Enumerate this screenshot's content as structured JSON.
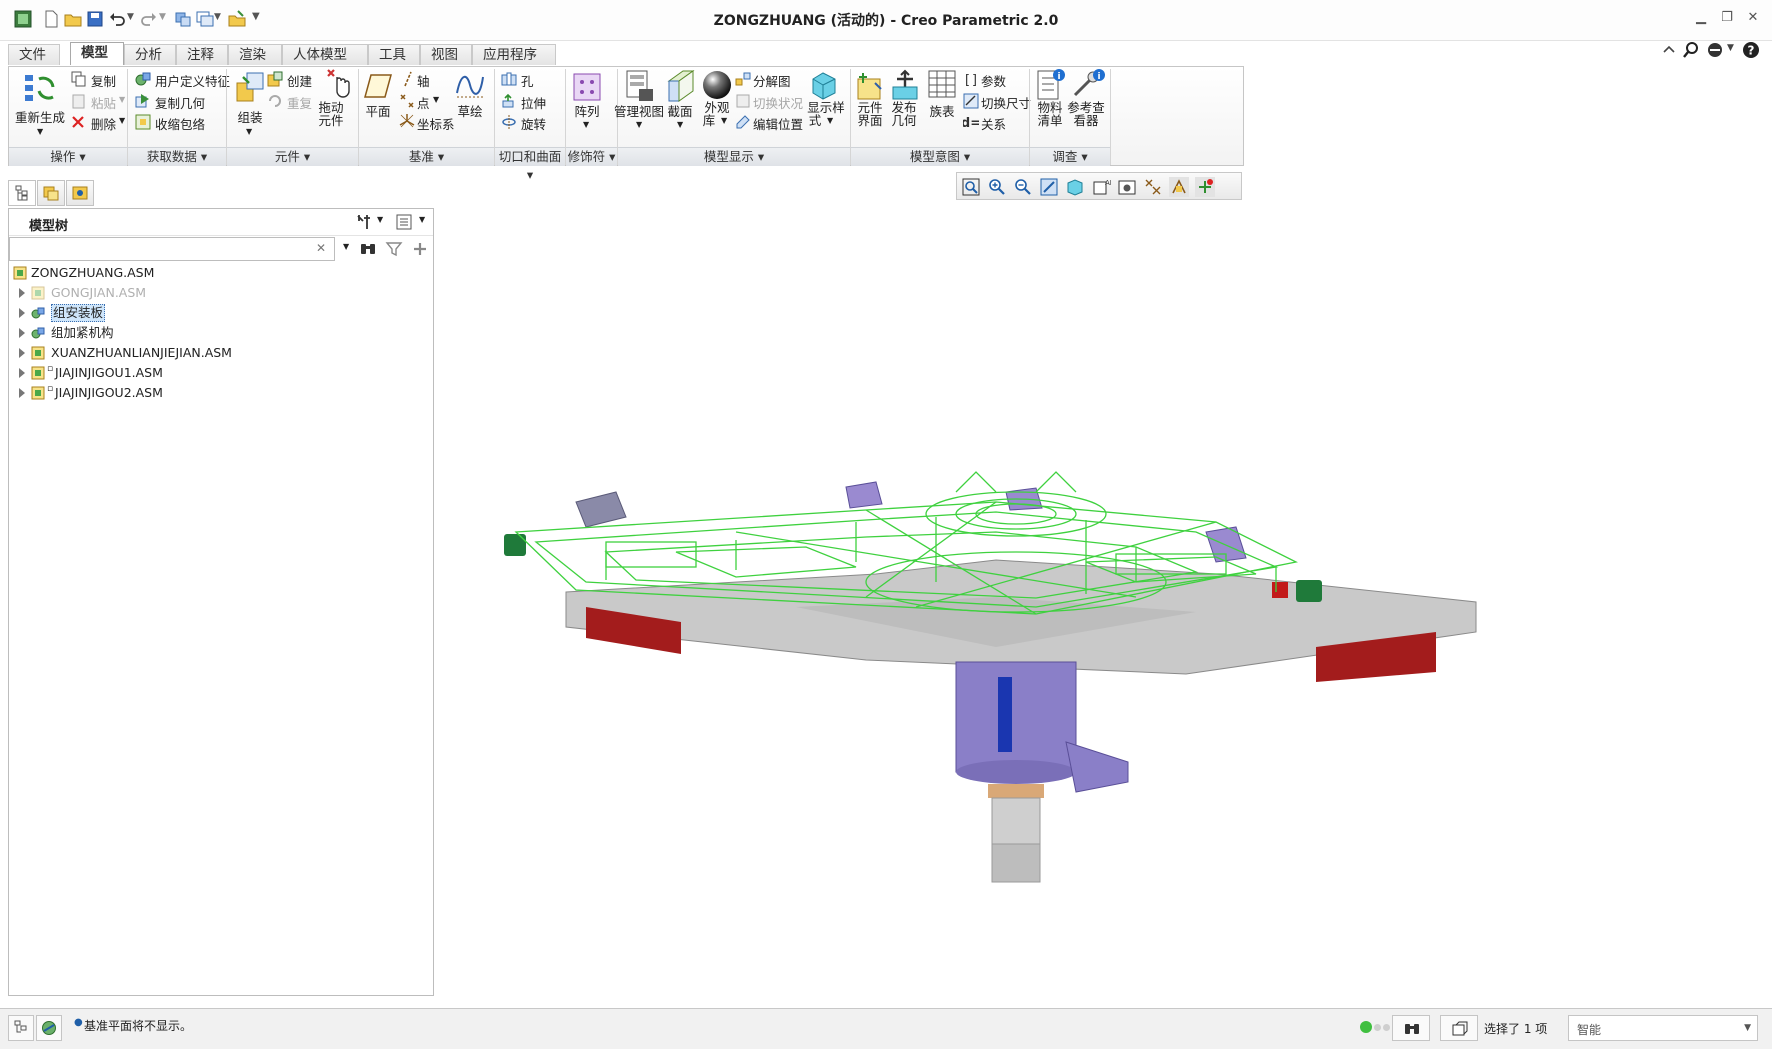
{
  "window": {
    "title": "ZONGZHUANG (活动的) - Creo Parametric 2.0",
    "min_glyph": "▁",
    "restore_glyph": "❐",
    "close_glyph": "✕"
  },
  "menu": {
    "tabs": [
      "文件",
      "模型",
      "分析",
      "注释",
      "渲染",
      "人体模型",
      "工具",
      "视图",
      "应用程序"
    ],
    "file_arrow": "▾"
  },
  "ribbon": {
    "groups": {
      "operations": {
        "label": "操作 ▾",
        "regenerate": "重新生成",
        "copy": "复制",
        "paste": "粘贴",
        "delete": "删除"
      },
      "get_data": {
        "label": "获取数据 ▾",
        "user_defined_feature": "用户定义特征",
        "copy_geometry": "复制几何",
        "shrinkwrap": "收缩包络"
      },
      "component": {
        "label": "元件 ▾",
        "assemble": "组装",
        "create": "创建",
        "repeat": "重复",
        "drag_l1": "拖动",
        "drag_l2": "元件"
      },
      "datum": {
        "label": "基准 ▾",
        "plane": "平面",
        "axis": "轴",
        "point": "点",
        "csys": "坐标系",
        "sketch": "草绘"
      },
      "cut_surface": {
        "label": "切口和曲面 ▾",
        "hole": "孔",
        "extrude": "拉伸",
        "revolve": "旋转"
      },
      "modifiers": {
        "label": "修饰符 ▾",
        "pattern": "阵列"
      },
      "model_display": {
        "label": "模型显示 ▾",
        "manage_views": "管理视图",
        "section": "截面",
        "appearance_l1": "外观",
        "appearance_l2": "库",
        "explode_view": "分解图",
        "toggle_status": "切换状况",
        "edit_position": "编辑位置",
        "display_style_l1": "显示样",
        "display_style_l2": "式"
      },
      "model_intent": {
        "label": "模型意图 ▾",
        "component_interface_l1": "元件",
        "component_interface_l2": "界面",
        "publish_geometry_l1": "发布",
        "publish_geometry_l2": "几何",
        "family_table": "族表",
        "parameters": "参数",
        "switch_dimensions": "切换尺寸",
        "relations": "关系"
      },
      "investigate": {
        "label": "调查 ▾",
        "bom_l1": "物料",
        "bom_l2": "清单",
        "ref_viewer_l1": "参考查",
        "ref_viewer_l2": "看器"
      }
    }
  },
  "navigator": {
    "title": "模型树",
    "search_clear": "✕",
    "tree": [
      {
        "name": "ZONGZHUANG.ASM",
        "level": 0,
        "expandable": false,
        "state": "normal"
      },
      {
        "name": "GONGJIAN.ASM",
        "level": 1,
        "expandable": true,
        "state": "suppressed"
      },
      {
        "name": "组安装板",
        "level": 1,
        "expandable": true,
        "state": "selected"
      },
      {
        "name": "组加紧机构",
        "level": 1,
        "expandable": true,
        "state": "normal"
      },
      {
        "name": "XUANZHUANLIANJIEJIAN.ASM",
        "level": 1,
        "expandable": true,
        "state": "normal"
      },
      {
        "name": "JIAJINJIGOU1.ASM",
        "level": 1,
        "expandable": true,
        "state": "normal"
      },
      {
        "name": "JIAJINJIGOU2.ASM",
        "level": 1,
        "expandable": true,
        "state": "normal"
      }
    ]
  },
  "status": {
    "message": "基准平面将不显示。",
    "selected": "选择了 1 项",
    "filter": "智能"
  },
  "colors": {
    "wireframe": "#3fd13f",
    "column": "#8a7fc8",
    "base_plate": "#c8c8c8",
    "red_beam": "#a31c1c",
    "selection": "#cfe6fb"
  }
}
